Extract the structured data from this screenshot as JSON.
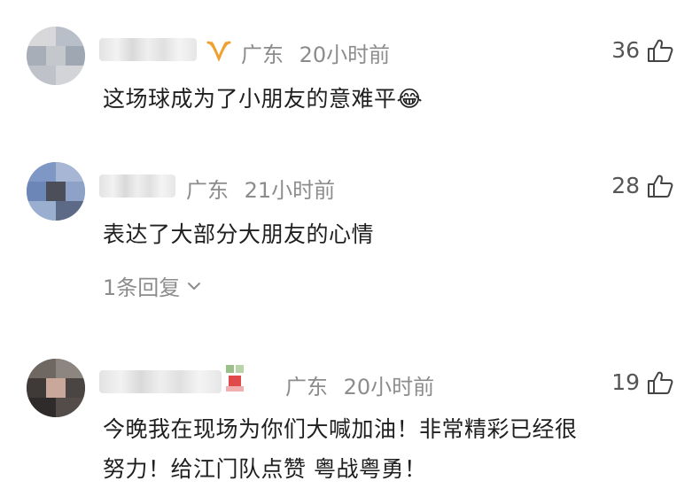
{
  "comments": [
    {
      "location": "广东",
      "time": "20小时前",
      "text": "这场球成为了小朋友的意难平😂",
      "likes": "36",
      "has_badge": true
    },
    {
      "location": "广东",
      "time": "21小时前",
      "text": "表达了大部分大朋友的心情",
      "likes": "28",
      "reply_label": "1条回复"
    },
    {
      "location": "广东",
      "time": "20小时前",
      "text_line1": "今晚我在现场为你们大喊加油！非常精彩已经很",
      "text_line2": "努力！给江门队点赞 粤战粤勇！",
      "likes": "19"
    }
  ],
  "icons": {
    "like": "thumbs-up-icon",
    "badge": "vip-badge-icon",
    "chevron": "chevron-down-icon"
  },
  "colors": {
    "badge": "#f0a030",
    "muted": "#8c8c8c",
    "text": "#1f1f1f"
  }
}
